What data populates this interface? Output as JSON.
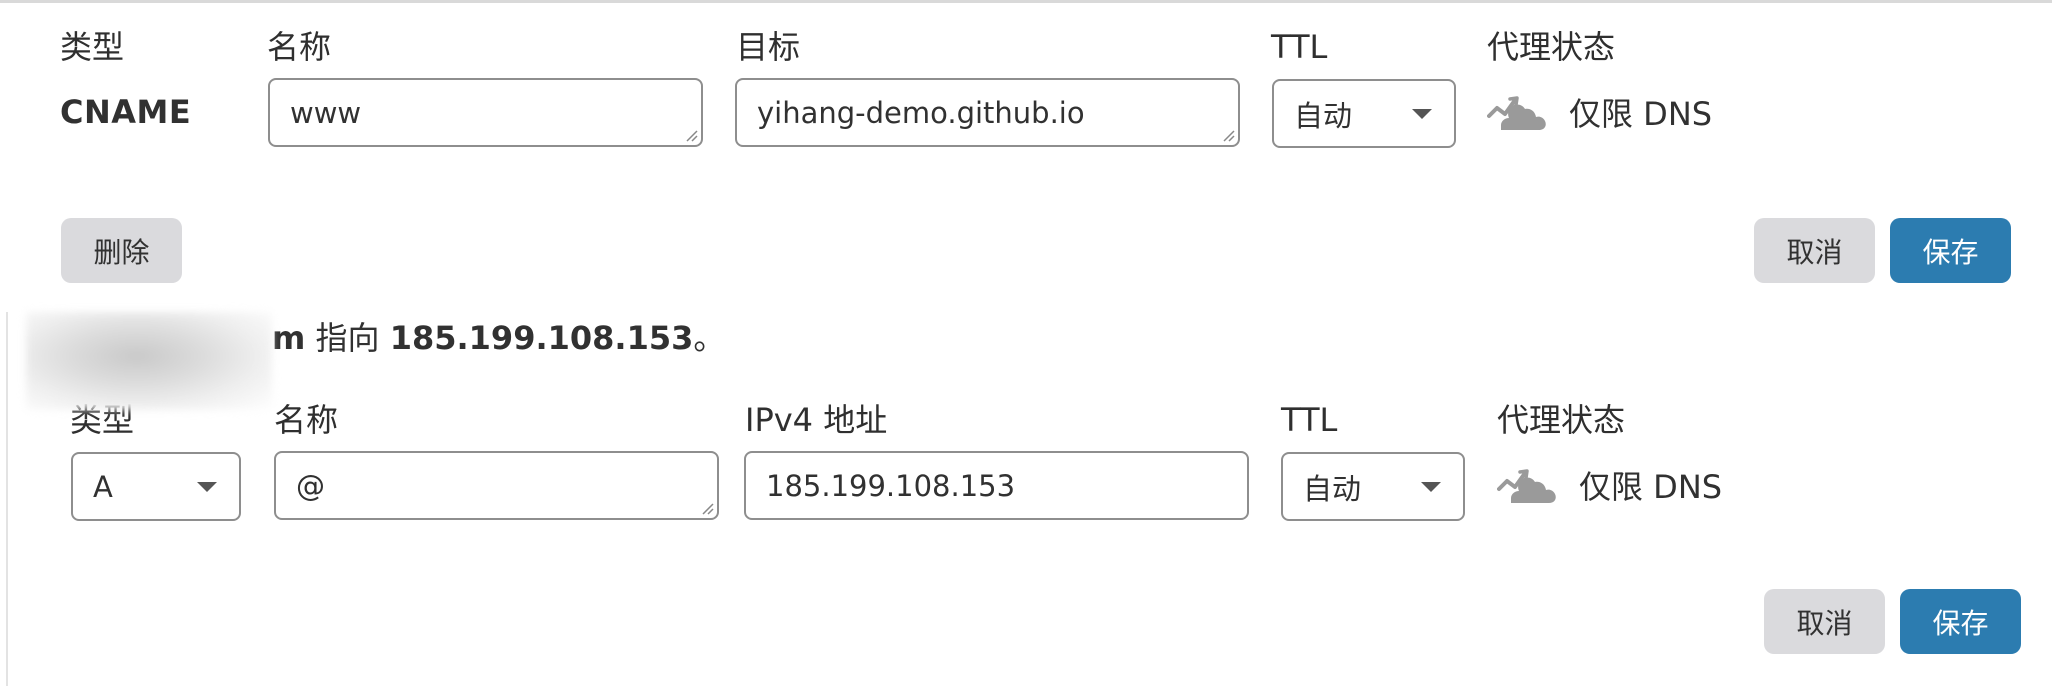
{
  "record1": {
    "labels": {
      "type": "类型",
      "name": "名称",
      "target": "目标",
      "ttl": "TTL",
      "proxy": "代理状态"
    },
    "type_value": "CNAME",
    "name_value": "www",
    "target_value": "yihang-demo.github.io",
    "ttl_value": "自动",
    "proxy_status": "仅限 DNS",
    "delete_label": "删除",
    "cancel_label": "取消",
    "save_label": "保存"
  },
  "record2": {
    "notice": {
      "domain_suffix": "m",
      "middle": " 指向 ",
      "ip": "185.199.108.153",
      "end": "。"
    },
    "labels": {
      "type": "类型",
      "name": "名称",
      "address": "IPv4 地址",
      "ttl": "TTL",
      "proxy": "代理状态"
    },
    "type_value": "A",
    "name_value": "@",
    "address_value": "185.199.108.153",
    "ttl_value": "自动",
    "proxy_status": "仅限 DNS",
    "cancel_label": "取消",
    "save_label": "保存"
  },
  "colors": {
    "accent": "#2c7cb0",
    "button_grey": "#dadadd",
    "field_border": "#8e8e8e",
    "cloud_grey": "#9a9a9a"
  },
  "icons": {
    "proxy": "dns-only-cloud-icon",
    "select": "caret-down-icon",
    "resize": "resize-handle-icon"
  }
}
